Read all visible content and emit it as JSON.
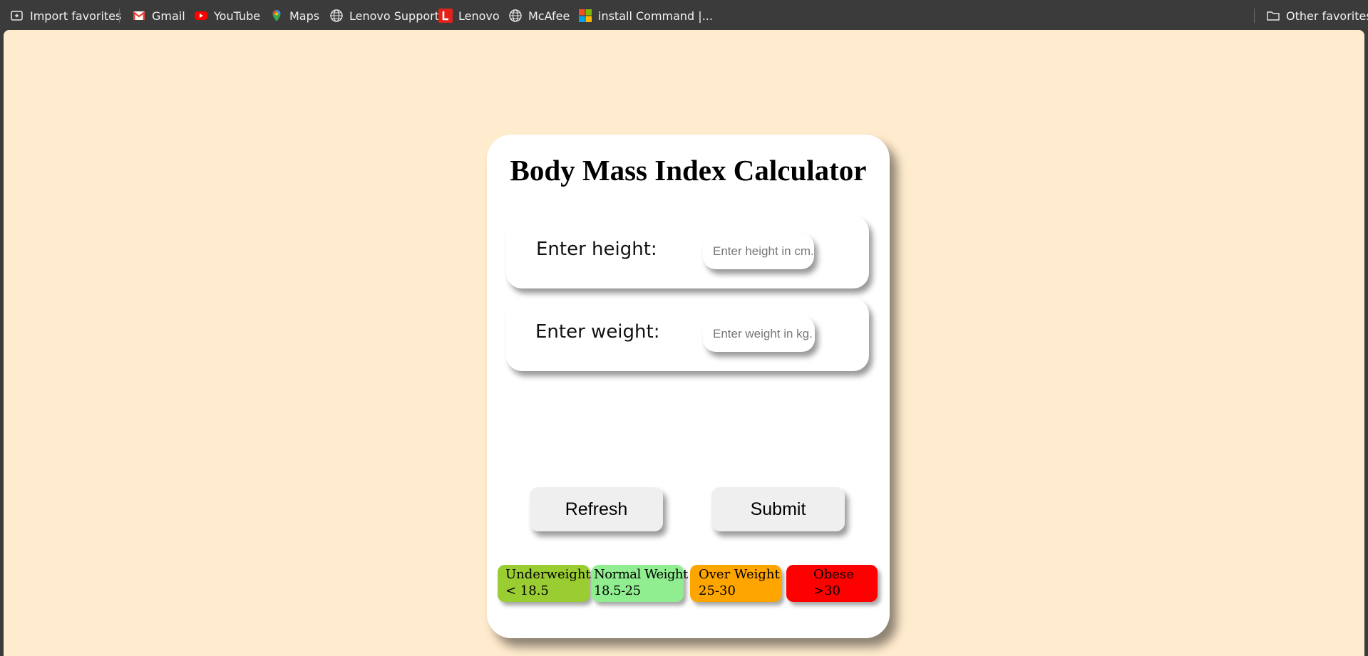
{
  "bookmarks": {
    "items": [
      {
        "label": "Import favorites",
        "icon": "import-favorites-icon"
      },
      {
        "label": "Gmail",
        "icon": "gmail-icon"
      },
      {
        "label": "YouTube",
        "icon": "youtube-icon"
      },
      {
        "label": "Maps",
        "icon": "maps-icon"
      },
      {
        "label": "Lenovo Support",
        "icon": "globe-icon"
      },
      {
        "label": "Lenovo",
        "icon": "lenovo-icon"
      },
      {
        "label": "McAfee",
        "icon": "globe-icon"
      },
      {
        "label": "install Command |...",
        "icon": "microsoft-icon"
      }
    ],
    "other_label": "Other favorites"
  },
  "calculator": {
    "title": "Body Mass Index Calculator",
    "height_label": "Enter height:",
    "height_placeholder": "Enter height in cm...",
    "height_value": "",
    "weight_label": "Enter weight:",
    "weight_placeholder": "Enter weight in kg...",
    "weight_value": "",
    "refresh_label": "Refresh",
    "submit_label": "Submit"
  },
  "legend": [
    {
      "name": "Underweight",
      "range": "< 18.5",
      "color": "#9acd32"
    },
    {
      "name": "Normal Weight",
      "range": "18.5-25",
      "color": "#90ee90"
    },
    {
      "name": "Over Weight",
      "range": "25-30",
      "color": "#ffa500"
    },
    {
      "name": "Obese",
      "range": ">30",
      "color": "#ff0000"
    }
  ],
  "colors": {
    "page_background": "#ffebcd",
    "card_background": "#ffffff",
    "browser_bar": "#3b3b3b"
  }
}
